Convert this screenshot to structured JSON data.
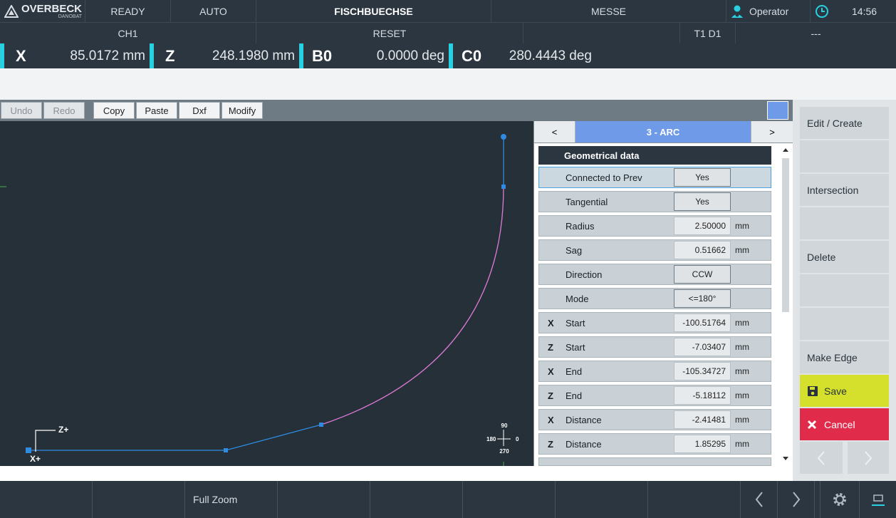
{
  "header": {
    "brand": "OVERBECK",
    "brand_sub": "DANOBAT",
    "status": "READY",
    "mode": "AUTO",
    "program": "FISCHBUECHSE",
    "measure": "MESSE",
    "user": "Operator",
    "time": "14:56"
  },
  "subheader": {
    "channel": "CH1",
    "reset": "RESET",
    "empty": "",
    "tool": "T1 D1",
    "dashes": "---"
  },
  "axes": [
    {
      "name": "X",
      "value": "85.0172 mm"
    },
    {
      "name": "Z",
      "value": "248.1980 mm"
    },
    {
      "name": "B0",
      "value": "0.0000 deg"
    },
    {
      "name": "C0",
      "value": "280.4443 deg"
    }
  ],
  "toolbar": {
    "undo": "Undo",
    "redo": "Redo",
    "copy": "Copy",
    "paste": "Paste",
    "dxf": "Dxf",
    "modify": "Modify"
  },
  "canvas": {
    "zplus": "Z+",
    "xplus": "X+",
    "compass": {
      "top": "90",
      "left": "180",
      "right": "0",
      "bottom": "270"
    }
  },
  "panel": {
    "prev": "<",
    "title": "3 - ARC",
    "next": ">",
    "section": "Geometrical data",
    "rows": [
      {
        "axis": "",
        "label": "Connected to Prev",
        "value": "Yes",
        "unit": "",
        "kind": "button"
      },
      {
        "axis": "",
        "label": "Tangential",
        "value": "Yes",
        "unit": "",
        "kind": "button"
      },
      {
        "axis": "",
        "label": "Radius",
        "value": "2.50000",
        "unit": "mm",
        "kind": "value"
      },
      {
        "axis": "",
        "label": "Sag",
        "value": "0.51662",
        "unit": "mm",
        "kind": "value"
      },
      {
        "axis": "",
        "label": "Direction",
        "value": "CCW",
        "unit": "",
        "kind": "button"
      },
      {
        "axis": "",
        "label": "Mode",
        "value": "<=180°",
        "unit": "",
        "kind": "button"
      },
      {
        "axis": "X",
        "label": "Start",
        "value": "-100.51764",
        "unit": "mm",
        "kind": "value"
      },
      {
        "axis": "Z",
        "label": "Start",
        "value": "-7.03407",
        "unit": "mm",
        "kind": "value"
      },
      {
        "axis": "X",
        "label": "End",
        "value": "-105.34727",
        "unit": "mm",
        "kind": "value"
      },
      {
        "axis": "Z",
        "label": "End",
        "value": "-5.18112",
        "unit": "mm",
        "kind": "value"
      },
      {
        "axis": "X",
        "label": "Distance",
        "value": "-2.41481",
        "unit": "mm",
        "kind": "value"
      },
      {
        "axis": "Z",
        "label": "Distance",
        "value": "1.85295",
        "unit": "mm",
        "kind": "value"
      }
    ]
  },
  "side": {
    "edit_create": "Edit / Create",
    "intersection": "Intersection",
    "delete": "Delete",
    "make_edge": "Make Edge",
    "save": "Save",
    "cancel": "Cancel"
  },
  "bottom": {
    "full_zoom": "Full Zoom"
  },
  "colors": {
    "accent": "#28d0e0",
    "panel_title": "#6f9ae8",
    "save": "#d4e02b",
    "cancel": "#e02b4b",
    "path_line": "#2f8ae0",
    "arc": "#e07ad8"
  }
}
